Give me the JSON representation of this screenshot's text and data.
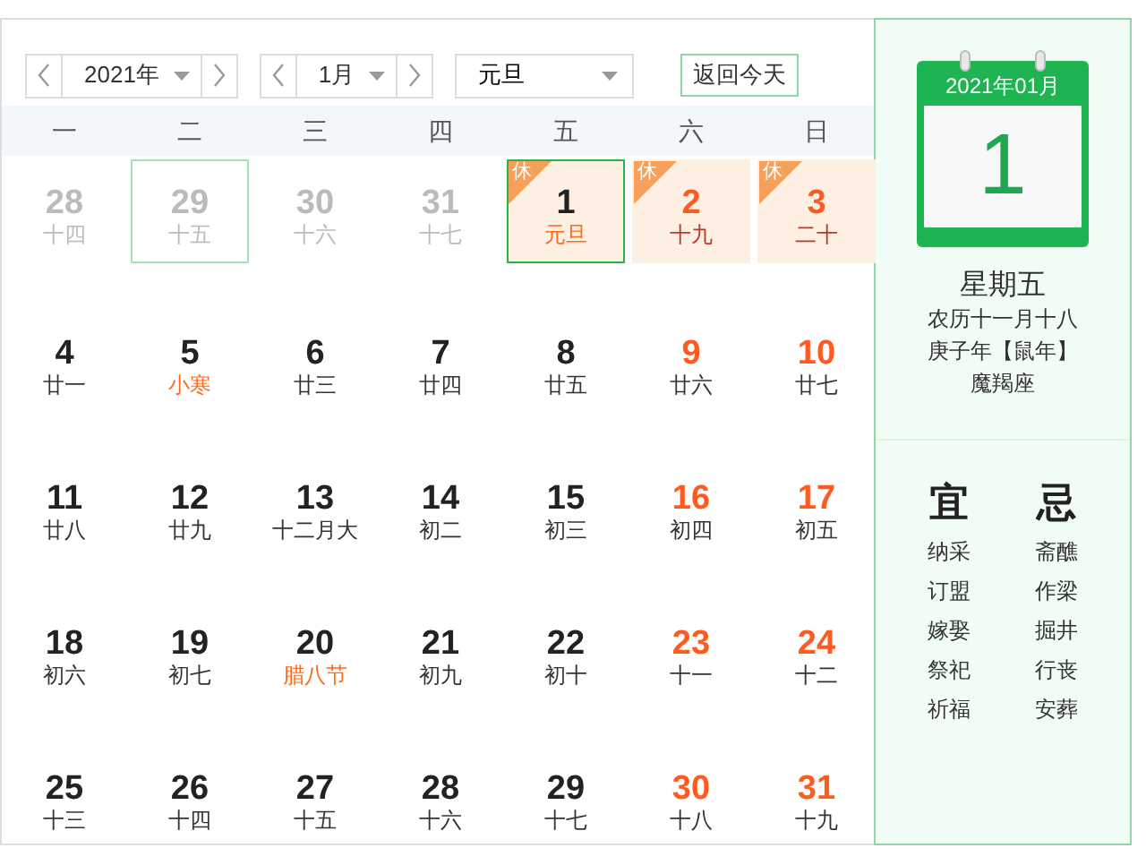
{
  "toolbar": {
    "year": "2021年",
    "month": "1月",
    "holiday": "元旦",
    "today_button": "返回今天"
  },
  "weekdays": [
    "一",
    "二",
    "三",
    "四",
    "五",
    "六",
    "日"
  ],
  "days": [
    {
      "number": "28",
      "lunar": "十四",
      "muted": true,
      "weekend": false,
      "festival": false,
      "rest": false,
      "selected": false,
      "highlighted": false
    },
    {
      "number": "29",
      "lunar": "十五",
      "muted": true,
      "weekend": false,
      "festival": false,
      "rest": false,
      "selected": false,
      "highlighted": true
    },
    {
      "number": "30",
      "lunar": "十六",
      "muted": true,
      "weekend": false,
      "festival": false,
      "rest": false,
      "selected": false,
      "highlighted": false
    },
    {
      "number": "31",
      "lunar": "十七",
      "muted": true,
      "weekend": false,
      "festival": false,
      "rest": false,
      "selected": false,
      "highlighted": false
    },
    {
      "number": "1",
      "lunar": "元旦",
      "muted": false,
      "weekend": false,
      "festival": true,
      "rest": true,
      "rest_label": "休",
      "selected": true,
      "highlighted": false
    },
    {
      "number": "2",
      "lunar": "十九",
      "muted": false,
      "weekend": true,
      "festival": false,
      "rest": true,
      "rest_label": "休",
      "selected": false,
      "highlighted": false
    },
    {
      "number": "3",
      "lunar": "二十",
      "muted": false,
      "weekend": true,
      "festival": false,
      "rest": true,
      "rest_label": "休",
      "selected": false,
      "highlighted": false
    },
    {
      "number": "4",
      "lunar": "廿一",
      "muted": false,
      "weekend": false,
      "festival": false,
      "rest": false,
      "selected": false,
      "highlighted": false
    },
    {
      "number": "5",
      "lunar": "小寒",
      "muted": false,
      "weekend": false,
      "festival": true,
      "rest": false,
      "selected": false,
      "highlighted": false
    },
    {
      "number": "6",
      "lunar": "廿三",
      "muted": false,
      "weekend": false,
      "festival": false,
      "rest": false,
      "selected": false,
      "highlighted": false
    },
    {
      "number": "7",
      "lunar": "廿四",
      "muted": false,
      "weekend": false,
      "festival": false,
      "rest": false,
      "selected": false,
      "highlighted": false
    },
    {
      "number": "8",
      "lunar": "廿五",
      "muted": false,
      "weekend": false,
      "festival": false,
      "rest": false,
      "selected": false,
      "highlighted": false
    },
    {
      "number": "9",
      "lunar": "廿六",
      "muted": false,
      "weekend": true,
      "festival": false,
      "rest": false,
      "selected": false,
      "highlighted": false
    },
    {
      "number": "10",
      "lunar": "廿七",
      "muted": false,
      "weekend": true,
      "festival": false,
      "rest": false,
      "selected": false,
      "highlighted": false
    },
    {
      "number": "11",
      "lunar": "廿八",
      "muted": false,
      "weekend": false,
      "festival": false,
      "rest": false,
      "selected": false,
      "highlighted": false
    },
    {
      "number": "12",
      "lunar": "廿九",
      "muted": false,
      "weekend": false,
      "festival": false,
      "rest": false,
      "selected": false,
      "highlighted": false
    },
    {
      "number": "13",
      "lunar": "十二月大",
      "muted": false,
      "weekend": false,
      "festival": false,
      "rest": false,
      "selected": false,
      "highlighted": false
    },
    {
      "number": "14",
      "lunar": "初二",
      "muted": false,
      "weekend": false,
      "festival": false,
      "rest": false,
      "selected": false,
      "highlighted": false
    },
    {
      "number": "15",
      "lunar": "初三",
      "muted": false,
      "weekend": false,
      "festival": false,
      "rest": false,
      "selected": false,
      "highlighted": false
    },
    {
      "number": "16",
      "lunar": "初四",
      "muted": false,
      "weekend": true,
      "festival": false,
      "rest": false,
      "selected": false,
      "highlighted": false
    },
    {
      "number": "17",
      "lunar": "初五",
      "muted": false,
      "weekend": true,
      "festival": false,
      "rest": false,
      "selected": false,
      "highlighted": false
    },
    {
      "number": "18",
      "lunar": "初六",
      "muted": false,
      "weekend": false,
      "festival": false,
      "rest": false,
      "selected": false,
      "highlighted": false
    },
    {
      "number": "19",
      "lunar": "初七",
      "muted": false,
      "weekend": false,
      "festival": false,
      "rest": false,
      "selected": false,
      "highlighted": false
    },
    {
      "number": "20",
      "lunar": "腊八节",
      "muted": false,
      "weekend": false,
      "festival": true,
      "rest": false,
      "selected": false,
      "highlighted": false
    },
    {
      "number": "21",
      "lunar": "初九",
      "muted": false,
      "weekend": false,
      "festival": false,
      "rest": false,
      "selected": false,
      "highlighted": false
    },
    {
      "number": "22",
      "lunar": "初十",
      "muted": false,
      "weekend": false,
      "festival": false,
      "rest": false,
      "selected": false,
      "highlighted": false
    },
    {
      "number": "23",
      "lunar": "十一",
      "muted": false,
      "weekend": true,
      "festival": false,
      "rest": false,
      "selected": false,
      "highlighted": false
    },
    {
      "number": "24",
      "lunar": "十二",
      "muted": false,
      "weekend": true,
      "festival": false,
      "rest": false,
      "selected": false,
      "highlighted": false
    },
    {
      "number": "25",
      "lunar": "十三",
      "muted": false,
      "weekend": false,
      "festival": false,
      "rest": false,
      "selected": false,
      "highlighted": false
    },
    {
      "number": "26",
      "lunar": "十四",
      "muted": false,
      "weekend": false,
      "festival": false,
      "rest": false,
      "selected": false,
      "highlighted": false
    },
    {
      "number": "27",
      "lunar": "十五",
      "muted": false,
      "weekend": false,
      "festival": false,
      "rest": false,
      "selected": false,
      "highlighted": false
    },
    {
      "number": "28",
      "lunar": "十六",
      "muted": false,
      "weekend": false,
      "festival": false,
      "rest": false,
      "selected": false,
      "highlighted": false
    },
    {
      "number": "29",
      "lunar": "十七",
      "muted": false,
      "weekend": false,
      "festival": false,
      "rest": false,
      "selected": false,
      "highlighted": false
    },
    {
      "number": "30",
      "lunar": "十八",
      "muted": false,
      "weekend": true,
      "festival": false,
      "rest": false,
      "selected": false,
      "highlighted": false
    },
    {
      "number": "31",
      "lunar": "十九",
      "muted": false,
      "weekend": true,
      "festival": false,
      "rest": false,
      "selected": false,
      "highlighted": false
    }
  ],
  "detail": {
    "calendar_header": "2021年01月",
    "calendar_day": "1",
    "weekday": "星期五",
    "lunar_date": "农历十一月十八",
    "year_name": "庚子年【鼠年】",
    "zodiac": "魔羯座",
    "suitable": {
      "title": "宜",
      "items": [
        "纳采",
        "订盟",
        "嫁娶",
        "祭祀",
        "祈福"
      ]
    },
    "avoid": {
      "title": "忌",
      "items": [
        "斋醮",
        "作梁",
        "掘井",
        "行丧",
        "安葬"
      ]
    }
  }
}
